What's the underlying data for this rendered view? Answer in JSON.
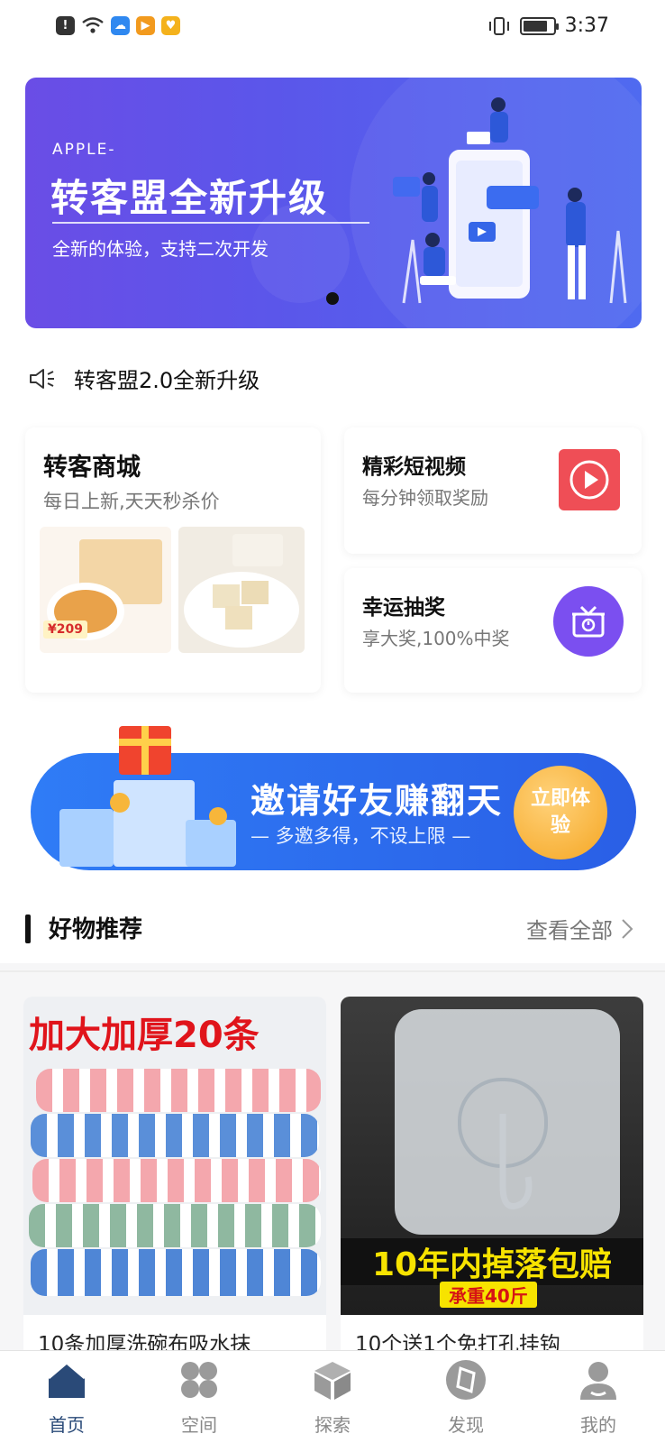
{
  "status_bar": {
    "time": "3:37"
  },
  "banner": {
    "subtitle": "APPLE-",
    "title": "转客盟全新升级",
    "description": "全新的体验，支持二次开发"
  },
  "notice": {
    "text": "转客盟2.0全新升级",
    "icon": "speaker-icon"
  },
  "features": {
    "mall": {
      "title": "转客商城",
      "subtitle": "每日上新,天天秒杀价",
      "price_tag": "¥209"
    },
    "video": {
      "title": "精彩短视频",
      "subtitle": "每分钟领取奖励",
      "icon": "play-icon",
      "icon_color": "#ef4e56"
    },
    "lottery": {
      "title": "幸运抽奖",
      "subtitle": "享大奖,100%中奖",
      "icon": "gift-icon",
      "icon_color": "#7b4ff0"
    }
  },
  "invite_banner": {
    "title": "邀请好友赚翻天",
    "subtitle": "— 多邀多得，不设上限 —",
    "cta": "立即体验"
  },
  "recommend": {
    "title": "好物推荐",
    "see_all": "查看全部",
    "products": [
      {
        "title": "10条加厚洗碗布吸水抹",
        "overlay": "加大加厚20条"
      },
      {
        "title": "10个送1个免打孔挂钩",
        "overlay": "10年内掉落包赔",
        "badge": "承重40斤"
      }
    ]
  },
  "tabs": [
    {
      "label": "首页",
      "icon": "home-icon",
      "active": true
    },
    {
      "label": "空间",
      "icon": "grid-icon",
      "active": false
    },
    {
      "label": "探索",
      "icon": "box-icon",
      "active": false
    },
    {
      "label": "发现",
      "icon": "compass-icon",
      "active": false
    },
    {
      "label": "我的",
      "icon": "user-icon",
      "active": false
    }
  ],
  "colors": {
    "accent": "#2a4a78",
    "banner": "#5b56ea",
    "invite": "#2f6ef0"
  }
}
